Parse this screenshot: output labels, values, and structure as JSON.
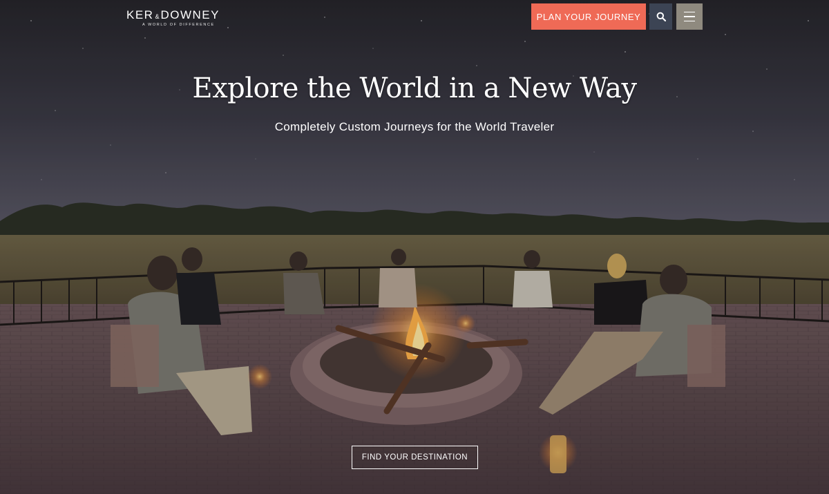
{
  "brand": {
    "name_left": "KER",
    "name_amp": "&",
    "name_right": "DOWNEY",
    "tagline": "A WORLD OF DIFFERENCE"
  },
  "header": {
    "plan_button": "PLAN YOUR JOURNEY",
    "search_icon": "search-icon",
    "menu_icon": "hamburger-menu-icon"
  },
  "hero": {
    "title": "Explore the World in a New Way",
    "subtitle": "Completely Custom Journeys for the World Traveler",
    "cta": "FIND YOUR DESTINATION"
  },
  "colors": {
    "plan_button": "#ef6a56",
    "search_button": "#3c4454",
    "menu_button": "#8f8a7f"
  }
}
